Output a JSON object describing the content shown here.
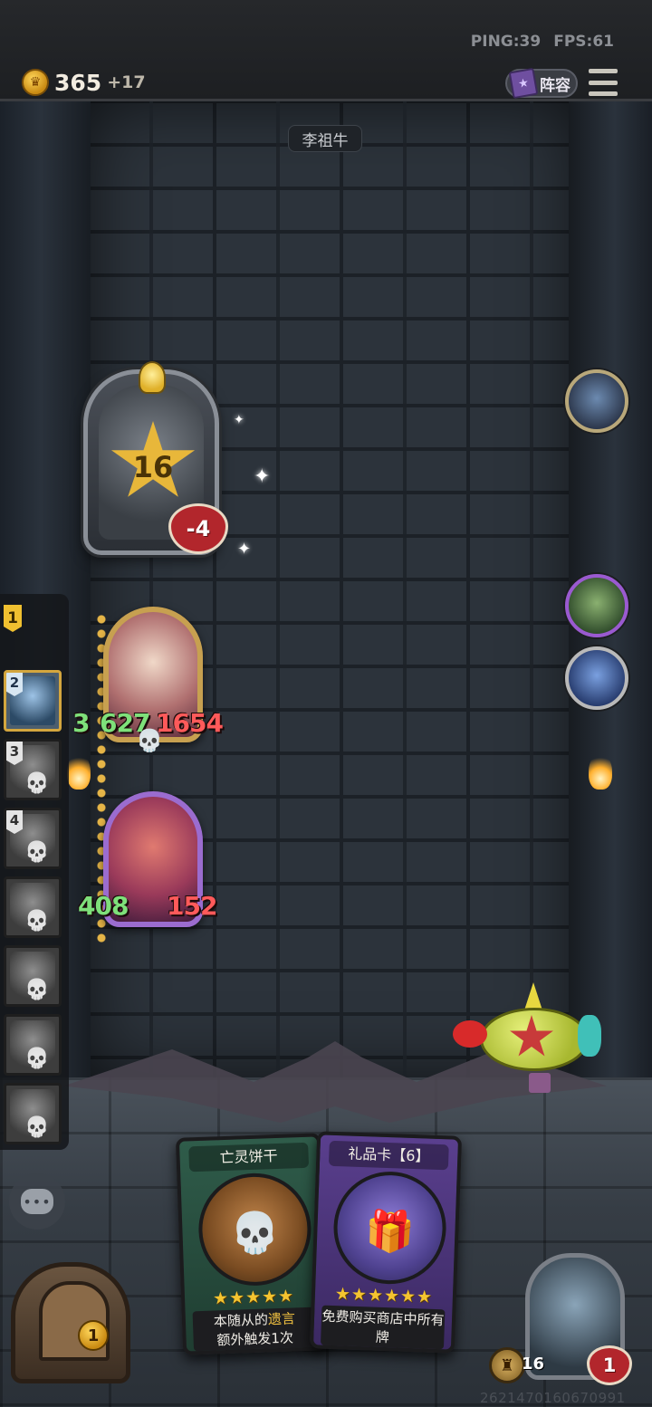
{
  "topbar": {
    "ping_label": "PING:39",
    "fps_label": "FPS:61",
    "gold_amount": "365",
    "gold_income": "+17",
    "lineup_label": "阵容",
    "menu_icon": "hamburger-menu-icon"
  },
  "opponent": {
    "name": "李祖牛",
    "hero_level": "16",
    "hero_health": "-4"
  },
  "timeline": {
    "current_round": "1",
    "slots": [
      {
        "number": "2",
        "active": true
      },
      {
        "number": "3",
        "active": false
      },
      {
        "number": "4",
        "active": false
      },
      {
        "number": "",
        "active": false
      },
      {
        "number": "",
        "active": false
      },
      {
        "number": "",
        "active": false
      },
      {
        "number": "",
        "active": false
      }
    ]
  },
  "board": {
    "minions": [
      {
        "attack": "3",
        "mid": "627",
        "health": "1654"
      },
      {
        "attack": "408",
        "health": "152"
      }
    ]
  },
  "shop": {
    "cards": [
      {
        "title": "亡灵饼干",
        "stars": "★★★★★",
        "text_prefix": "本随从的",
        "keyword": "遗言",
        "text_suffix": "额外触发1次",
        "icon": "cookie-skull-icon"
      },
      {
        "title": "礼品卡【6】",
        "stars": "★★★★★★",
        "text": "免费购买商店中所有牌",
        "icon": "gift-card-icon"
      }
    ],
    "reroll_cost": "1"
  },
  "player": {
    "armor": "16",
    "health": "1",
    "uid": "2621470160670991"
  },
  "chat": {
    "icon": "chat-bubble-icon",
    "glyph": "•••"
  },
  "colors": {
    "gold": "#f0c030",
    "health_red": "#b2262c",
    "attack_green": "#7ee07a"
  }
}
